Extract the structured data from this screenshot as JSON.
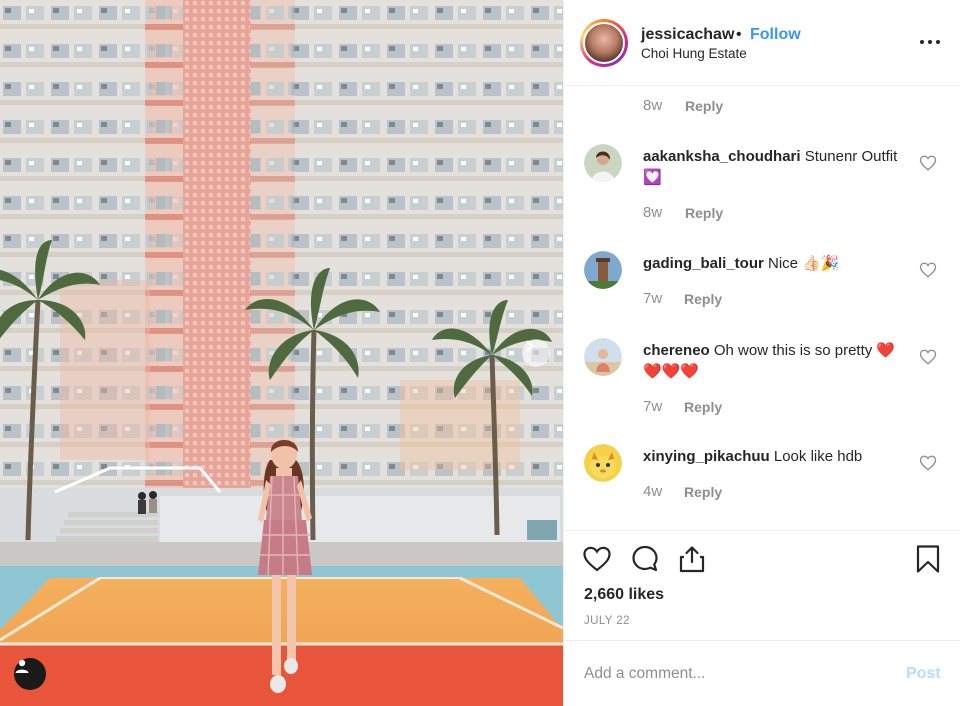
{
  "post": {
    "photo_alt": "",
    "header": {
      "username": "jessicachaw",
      "separator": "•",
      "follow_label": "Follow",
      "location": "Choi Hung Estate"
    },
    "top_meta": {
      "time": "8w",
      "reply_label": "Reply"
    },
    "comments": [
      {
        "username": "aakanksha_choudhari",
        "text": "Stunenr Outfit💟",
        "time": "8w",
        "reply_label": "Reply"
      },
      {
        "username": "gading_bali_tour",
        "text": "Nice 👍🏻🎉",
        "time": "7w",
        "reply_label": "Reply"
      },
      {
        "username": "chereneo",
        "text": "Oh wow this is so pretty ❤️❤️❤️❤️",
        "time": "7w",
        "reply_label": "Reply"
      },
      {
        "username": "xinying_pikachuu",
        "text": "Look like hdb",
        "time": "4w",
        "reply_label": "Reply"
      }
    ],
    "likes": "2,660 likes",
    "date": "JULY 22",
    "add_comment": {
      "placeholder": "Add a comment...",
      "post_label": "Post"
    }
  },
  "icons": {
    "like": "heart-icon",
    "comment": "comment-icon",
    "share": "share-icon",
    "save": "bookmark-icon",
    "more": "more-options-icon",
    "comment_like": "heart-icon",
    "user_tag": "user-icon",
    "next": "chevron-right-icon"
  },
  "colors": {
    "accent": "#3897f0",
    "post_disabled": "#b2dffc",
    "muted": "#8e8e8e",
    "text": "#262626",
    "divider": "#efefef"
  }
}
